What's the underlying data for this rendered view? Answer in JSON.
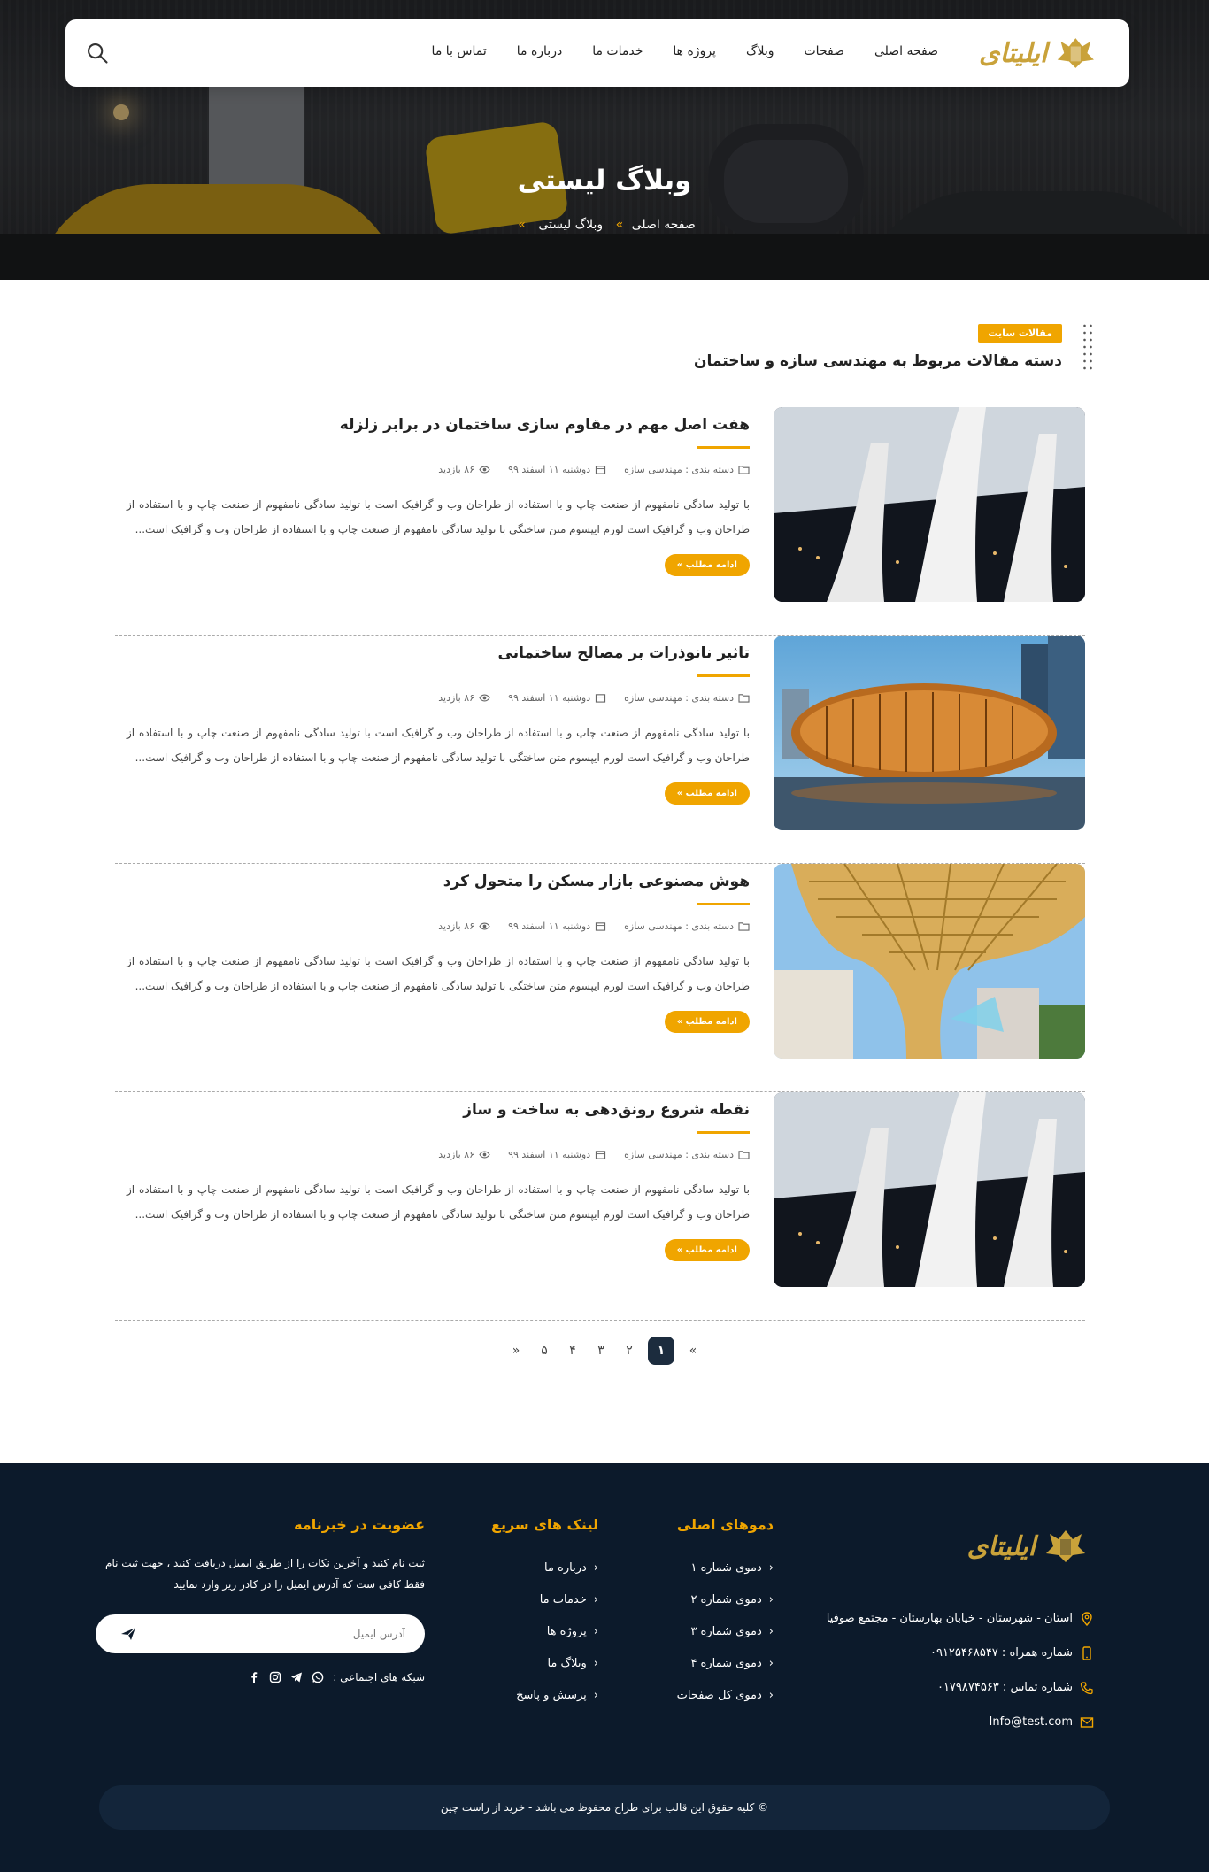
{
  "brand": {
    "name": "ایلیتای"
  },
  "nav": {
    "items": [
      "صفحه اصلی",
      "صفحات",
      "وبلاگ",
      "پروژه ها",
      "خدمات ما",
      "درباره ما",
      "تماس با ما"
    ]
  },
  "hero": {
    "title": "وبلاگ لیستی",
    "breadcrumb": {
      "home": "صفحه اصلی",
      "current": "وبلاگ لیستی",
      "sep1": "»",
      "sep2": "»"
    }
  },
  "section": {
    "badge": "مقالات سایت",
    "title": "دسته مقالات مربوط به مهندسی سازه و ساختمان"
  },
  "posts": [
    {
      "title": "هفت اصل مهم در مقاوم سازی ساختمان در برابر زلزله",
      "category": "دسته بندی : مهندسی سازه",
      "date": "دوشنبه ۱۱ اسفند ۹۹",
      "views": "۸۶ بازدید",
      "excerpt": "با تولید سادگی نامفهوم از صنعت چاپ و با استفاده از طراحان وب و گرافیک است با تولید سادگی نامفهوم از صنعت چاپ و با استفاده از طراحان وب و گرافیک است لورم ایپسوم متن ساختگی با تولید سادگی نامفهوم از صنعت چاپ و با استفاده از طراحان وب و گرافیک است...",
      "more": "ادامه مطلب »"
    },
    {
      "title": "تاثیر نانوذرات بر مصالح ساختمانی",
      "category": "دسته بندی : مهندسی سازه",
      "date": "دوشنبه ۱۱ اسفند ۹۹",
      "views": "۸۶ بازدید",
      "excerpt": "با تولید سادگی نامفهوم از صنعت چاپ و با استفاده از طراحان وب و گرافیک است با تولید سادگی نامفهوم از صنعت چاپ و با استفاده از طراحان وب و گرافیک است لورم ایپسوم متن ساختگی با تولید سادگی نامفهوم از صنعت چاپ و با استفاده از طراحان وب و گرافیک است...",
      "more": "ادامه مطلب »"
    },
    {
      "title": "هوش مصنوعی بازار مسکن را متحول کرد",
      "category": "دسته بندی : مهندسی سازه",
      "date": "دوشنبه ۱۱ اسفند ۹۹",
      "views": "۸۶ بازدید",
      "excerpt": "با تولید سادگی نامفهوم از صنعت چاپ و با استفاده از طراحان وب و گرافیک است با تولید سادگی نامفهوم از صنعت چاپ و با استفاده از طراحان وب و گرافیک است لورم ایپسوم متن ساختگی با تولید سادگی نامفهوم از صنعت چاپ و با استفاده از طراحان وب و گرافیک است...",
      "more": "ادامه مطلب »"
    },
    {
      "title": "نقطه شروع رونق‌دهی به ساخت و ساز",
      "category": "دسته بندی : مهندسی سازه",
      "date": "دوشنبه ۱۱ اسفند ۹۹",
      "views": "۸۶ بازدید",
      "excerpt": "با تولید سادگی نامفهوم از صنعت چاپ و با استفاده از طراحان وب و گرافیک است با تولید سادگی نامفهوم از صنعت چاپ و با استفاده از طراحان وب و گرافیک است لورم ایپسوم متن ساختگی با تولید سادگی نامفهوم از صنعت چاپ و با استفاده از طراحان وب و گرافیک است...",
      "more": "ادامه مطلب »"
    }
  ],
  "pagination": {
    "prev": "»",
    "pages": [
      "۱",
      "۲",
      "۳",
      "۴",
      "۵"
    ],
    "next": "«",
    "current": "۱"
  },
  "footer": {
    "contact": {
      "address": "استان - شهرستان - خیابان بهارستان - مجتمع صوفیا",
      "mobile": "شماره همراه : ۰۹۱۲۵۴۶۸۵۴۷",
      "phone": "شماره تماس : ۰۱۷۹۸۷۴۵۶۳",
      "email": "Info@test.com"
    },
    "demos": {
      "title": "دموهای اصلی",
      "items": [
        "دموی شماره ۱",
        "دموی شماره ۲",
        "دموی شماره ۳",
        "دموی شماره ۴",
        "دموی کل صفحات"
      ]
    },
    "quick": {
      "title": "لینک های سریع",
      "items": [
        "درباره ما",
        "خدمات ما",
        "پروژه ها",
        "وبلاگ ما",
        "پرسش و پاسخ"
      ]
    },
    "newsletter": {
      "title": "عضویت در خبرنامه",
      "text": "ثبت نام کنید و آخرین نکات را از طریق ایمیل دریافت کنید ، جهت ثبت نام فقط کافی ست که آدرس ایمیل را در کادر زیر وارد نمایید",
      "placeholder": "آدرس ایمیل",
      "social_label": "شبکه های اجتماعی :"
    },
    "copyright": "© کلیه حقوق این قالب برای طراح محفوظ می باشد -  خرید از راست چین"
  },
  "colors": {
    "accent": "#f0a500",
    "footer_bg": "#0c1a2b",
    "brand_gold": "#c9a23a"
  },
  "icons": [
    "search-icon",
    "folder-icon",
    "calendar-icon",
    "eye-icon",
    "location-icon",
    "mobile-icon",
    "phone-icon",
    "mail-icon",
    "send-icon",
    "whatsapp-icon",
    "telegram-icon",
    "instagram-icon",
    "facebook-icon"
  ]
}
